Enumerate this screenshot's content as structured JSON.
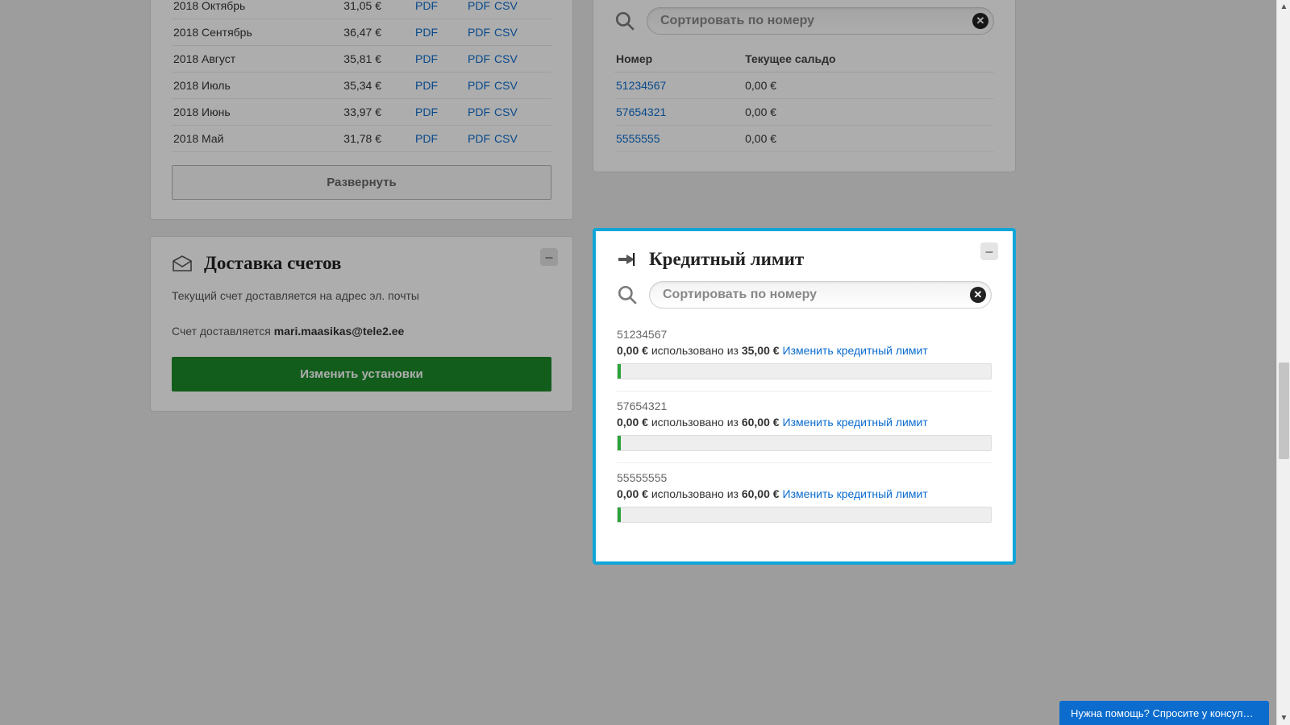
{
  "invoices": {
    "rows": [
      {
        "period": "2018 Октябрь",
        "amount": "31,05 €",
        "pdf": "PDF",
        "det_pdf": "PDF",
        "det_csv": "CSV"
      },
      {
        "period": "2018 Сентябрь",
        "amount": "36,47 €",
        "pdf": "PDF",
        "det_pdf": "PDF",
        "det_csv": "CSV"
      },
      {
        "period": "2018 Август",
        "amount": "35,81 €",
        "pdf": "PDF",
        "det_pdf": "PDF",
        "det_csv": "CSV"
      },
      {
        "period": "2018 Июль",
        "amount": "35,34 €",
        "pdf": "PDF",
        "det_pdf": "PDF",
        "det_csv": "CSV"
      },
      {
        "period": "2018 Июнь",
        "amount": "33,97 €",
        "pdf": "PDF",
        "det_pdf": "PDF",
        "det_csv": "CSV"
      },
      {
        "period": "2018 Май",
        "amount": "31,78 €",
        "pdf": "PDF",
        "det_pdf": "PDF",
        "det_csv": "CSV"
      }
    ],
    "expand": "Развернуть"
  },
  "delivery": {
    "title": "Доставка счетов",
    "line1": "Текущий счет доставляется на адрес эл. почты",
    "line2_prefix": "Счет доставляется ",
    "email": "mari.maasikas@tele2.ee",
    "button": "Изменить установки"
  },
  "balance": {
    "search_placeholder": "Сортировать по номеру",
    "th_number": "Номер",
    "th_balance": "Текущее сальдо",
    "rows": [
      {
        "number": "51234567",
        "balance": "0,00 €"
      },
      {
        "number": "57654321",
        "balance": "0,00 €"
      },
      {
        "number": "5555555",
        "balance": "0,00 €"
      }
    ]
  },
  "credit": {
    "title": "Кредитный лимит",
    "search_placeholder": "Сортировать по номеру",
    "used_word": "использовано из",
    "change_label": "Изменить кредитный лимит",
    "items": [
      {
        "number": "51234567",
        "used": "0,00 €",
        "limit": "35,00 €"
      },
      {
        "number": "57654321",
        "used": "0,00 €",
        "limit": "60,00 €"
      },
      {
        "number": "55555555",
        "used": "0,00 €",
        "limit": "60,00 €"
      }
    ]
  },
  "chat": {
    "label": "Нужна помощь? Спросите у консул…"
  }
}
